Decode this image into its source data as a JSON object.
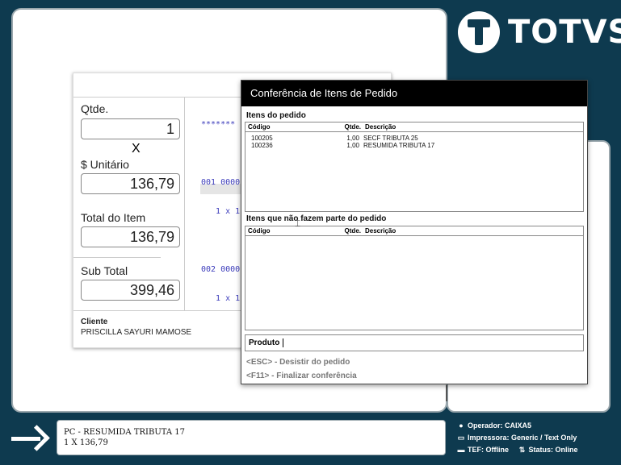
{
  "brand": {
    "logo_text": "TOTVS"
  },
  "sale": {
    "qty_label": "Qtde.",
    "qty_value": "1",
    "times_symbol": "X",
    "unit_label": "$ Unitário",
    "unit_value": "136,79",
    "item_total_label": "Total do Item",
    "item_total_value": "136,79",
    "subtotal_label": "Sub Total",
    "subtotal_value": "399,46",
    "receipt_lines": [
      "*******",
      "",
      "001 0000",
      "   1 x 1",
      "",
      "002 0000",
      "   1 x 1"
    ],
    "client_label": "Cliente",
    "client_name": "PRISCILLA SAYURI MAMOSE"
  },
  "dialog": {
    "title": "Conferência de Itens de Pedido",
    "section_items": "Itens do pedido",
    "section_extra": "Itens que não fazem parte do pedido",
    "columns": {
      "code": "Código",
      "qty": "Qtde.",
      "desc": "Descrição"
    },
    "items": [
      {
        "code": "100205",
        "qty": "1,00",
        "desc": "SECF TRIBUTA 25"
      },
      {
        "code": "100236",
        "qty": "1,00",
        "desc": "RESUMIDA TRIBUTA 17"
      }
    ],
    "extra_items": [],
    "produto_label": "Produto",
    "shortcut_esc": "<ESC> - Desistir do pedido",
    "shortcut_f11": "<F11> - Finalizar conferência"
  },
  "footer": {
    "line1": "PC - RESUMIDA TRIBUTA 17",
    "line2": "1 X 136,79"
  },
  "status": {
    "operator": "Operador: CAIXA5",
    "printer": "Impressora: Generic / Text Only",
    "tef": "TEF: Offline",
    "status": "Status: Online"
  }
}
